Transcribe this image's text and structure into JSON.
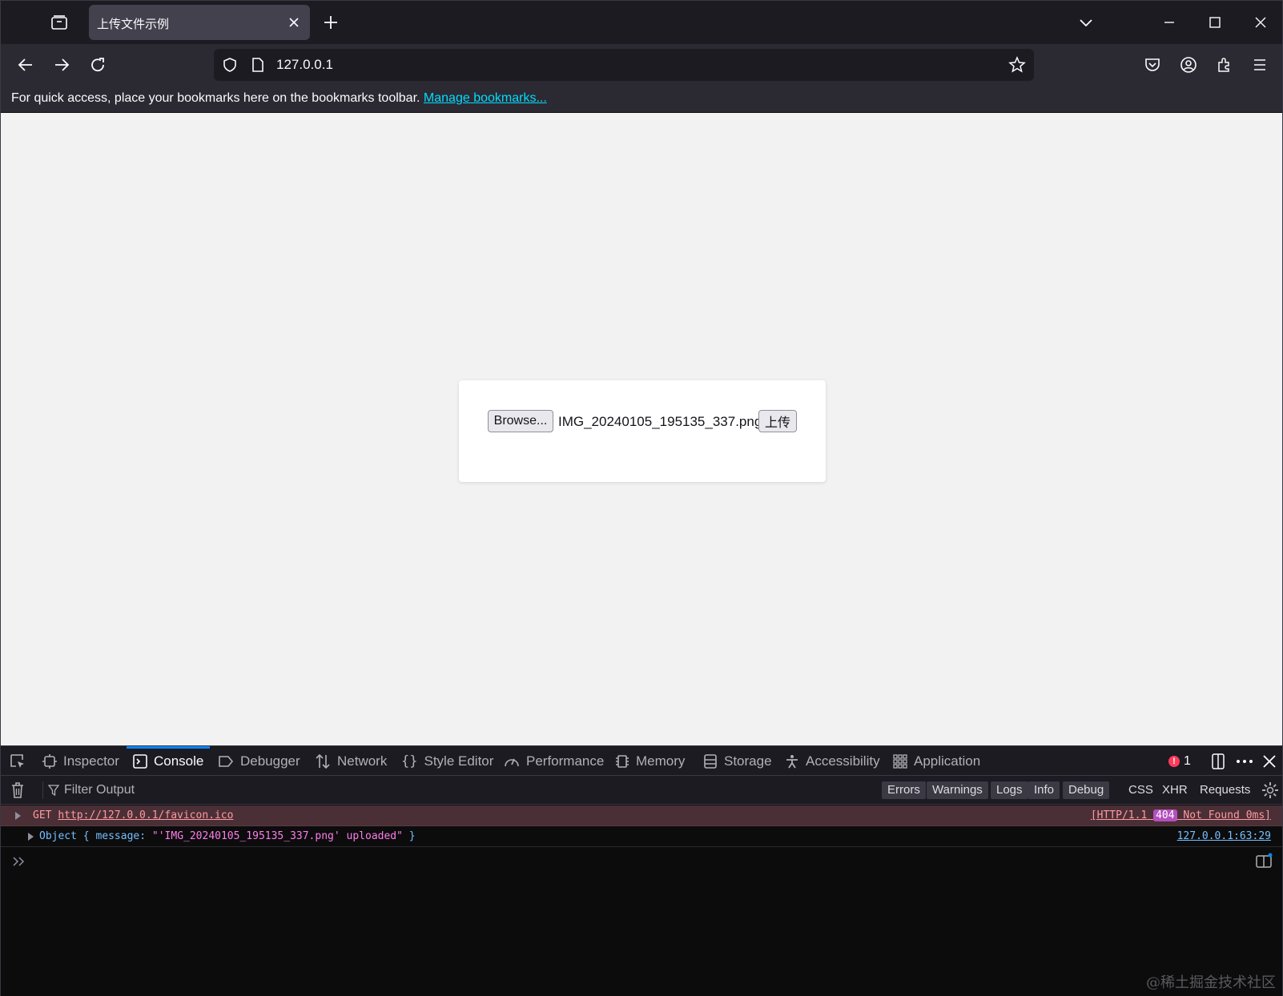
{
  "tab": {
    "title": "上传文件示例"
  },
  "urlbar": {
    "url": "127.0.0.1"
  },
  "bookmarks_bar": {
    "message": "For quick access, place your bookmarks here on the bookmarks toolbar.",
    "link": "Manage bookmarks..."
  },
  "page": {
    "browse_label": "Browse...",
    "filename": "IMG_20240105_195135_337.png",
    "upload_label": "上传"
  },
  "devtools": {
    "tabs": [
      {
        "label": "Inspector",
        "icon": "inspector-icon"
      },
      {
        "label": "Console",
        "icon": "console-icon",
        "active": true
      },
      {
        "label": "Debugger",
        "icon": "debugger-icon"
      },
      {
        "label": "Network",
        "icon": "network-icon"
      },
      {
        "label": "Style Editor",
        "icon": "style-editor-icon"
      },
      {
        "label": "Performance",
        "icon": "performance-icon"
      },
      {
        "label": "Memory",
        "icon": "memory-icon"
      },
      {
        "label": "Storage",
        "icon": "storage-icon"
      },
      {
        "label": "Accessibility",
        "icon": "accessibility-icon"
      },
      {
        "label": "Application",
        "icon": "application-icon"
      }
    ],
    "error_count": "1",
    "filter_placeholder": "Filter Output",
    "levels": [
      "Errors",
      "Warnings",
      "Logs",
      "Info",
      "Debug"
    ],
    "extra_filters": [
      "CSS",
      "XHR",
      "Requests"
    ],
    "logs": {
      "error": {
        "method": "GET",
        "url": "http://127.0.0.1/favicon.ico",
        "protocol": "[HTTP/1.1",
        "status": "404",
        "status_text": "Not Found 0ms]"
      },
      "object": {
        "prefix": "Object { message: ",
        "value": "\"'IMG_20240105_195135_337.png' uploaded\"",
        "suffix": " }",
        "location": "127.0.0.1:63:29"
      }
    }
  },
  "watermark": "@稀土掘金技术社区",
  "colors": {
    "accent": "#0a84ff",
    "link": "#00ddff",
    "error_bg": "#4b2f36",
    "status_badge": "#b44fbf"
  }
}
